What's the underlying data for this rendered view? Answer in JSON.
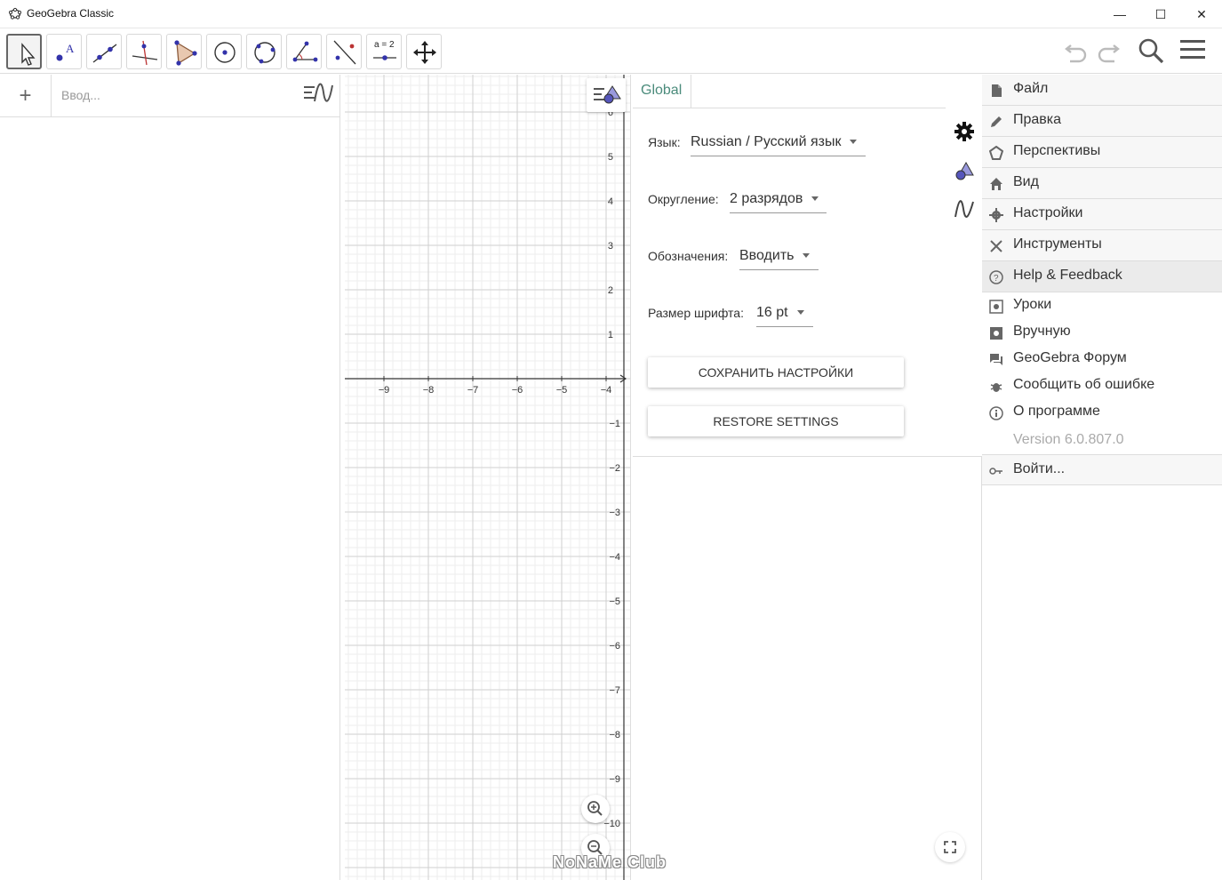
{
  "window": {
    "title": "GeoGebra Classic",
    "minimize": "—",
    "maximize": "☐",
    "close": "✕"
  },
  "toolbar": {
    "eq_tool_label": "a = 2"
  },
  "algebra": {
    "add_label": "+",
    "input_placeholder": "Ввод..."
  },
  "graphics": {
    "x_ticks": [
      "−9",
      "−8",
      "−7",
      "−6",
      "−5",
      "−4"
    ],
    "y_ticks_pos": [
      "6",
      "5",
      "4",
      "3",
      "2",
      "1"
    ],
    "y_ticks_neg": [
      "−1",
      "−2",
      "−3",
      "−4",
      "−5",
      "−6",
      "−7",
      "−8",
      "−9",
      "−10"
    ]
  },
  "settings": {
    "tab_global": "Global",
    "language_label": "Язык:",
    "language_value": "Russian / Русский язык",
    "rounding_label": "Округление:",
    "rounding_value": "2 разрядов",
    "labeling_label": "Обозначения:",
    "labeling_value": "Вводить",
    "fontsize_label": "Размер шрифта:",
    "fontsize_value": "16 pt",
    "save_button": "СОХРАНИТЬ НАСТРОЙКИ",
    "restore_button": "RESTORE SETTINGS"
  },
  "menu": {
    "items": [
      {
        "label": "Файл",
        "icon": "file-icon"
      },
      {
        "label": "Правка",
        "icon": "pencil-icon"
      },
      {
        "label": "Перспективы",
        "icon": "perspectives-icon"
      },
      {
        "label": "Вид",
        "icon": "home-icon"
      },
      {
        "label": "Настройки",
        "icon": "gear-icon"
      },
      {
        "label": "Инструменты",
        "icon": "tools-icon"
      },
      {
        "label": "Help & Feedback",
        "icon": "help-icon"
      }
    ],
    "help_sub": [
      {
        "label": "Уроки",
        "icon": "tutorials-icon"
      },
      {
        "label": "Вручную",
        "icon": "manual-icon"
      },
      {
        "label": "GeoGebra Форум",
        "icon": "forum-icon"
      },
      {
        "label": "Сообщить об ошибке",
        "icon": "bug-icon"
      },
      {
        "label": "О программе",
        "icon": "info-icon"
      }
    ],
    "version": "Version 6.0.807.0",
    "signin": "Войти..."
  },
  "watermark": "NoNaMe Club"
}
